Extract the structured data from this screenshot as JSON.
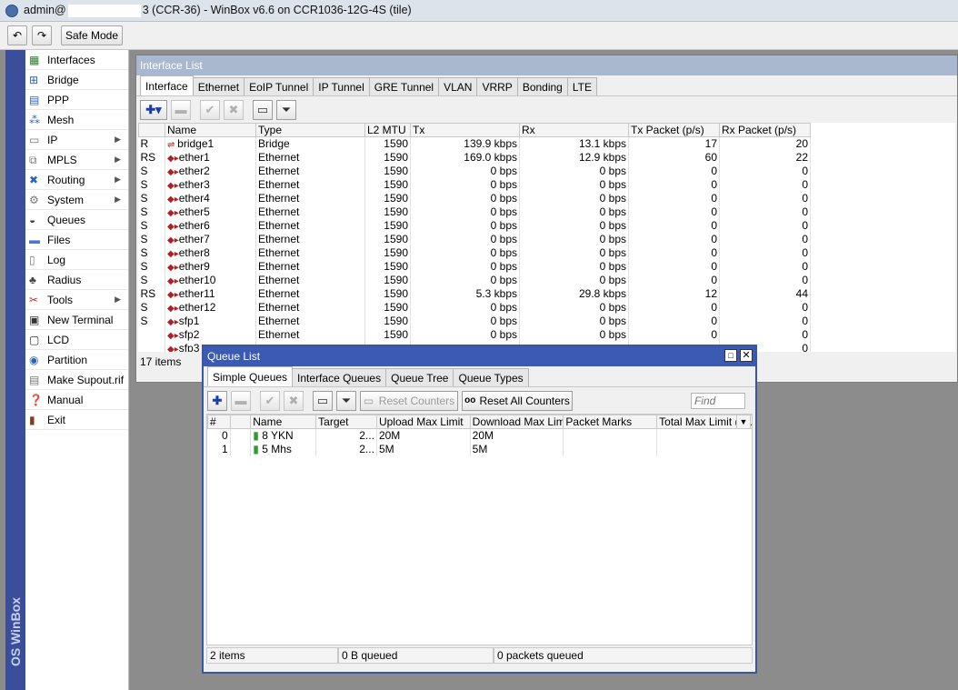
{
  "window": {
    "title_prefix": "admin@",
    "title_suffix": "3 (CCR-36) - WinBox v6.6 on CCR1036-12G-4S (tile)"
  },
  "toolbar": {
    "undo_icon": "undo-icon",
    "redo_icon": "redo-icon",
    "safe_mode": "Safe Mode"
  },
  "sidebar": {
    "brand": "OS WinBox",
    "items": [
      {
        "label": "Interfaces",
        "icon": "interfaces-icon",
        "sub": false
      },
      {
        "label": "Bridge",
        "icon": "bridge-icon",
        "sub": false
      },
      {
        "label": "PPP",
        "icon": "ppp-icon",
        "sub": false
      },
      {
        "label": "Mesh",
        "icon": "mesh-icon",
        "sub": false
      },
      {
        "label": "IP",
        "icon": "ip-icon",
        "sub": true
      },
      {
        "label": "MPLS",
        "icon": "mpls-icon",
        "sub": true
      },
      {
        "label": "Routing",
        "icon": "routing-icon",
        "sub": true
      },
      {
        "label": "System",
        "icon": "system-icon",
        "sub": true
      },
      {
        "label": "Queues",
        "icon": "queues-icon",
        "sub": false
      },
      {
        "label": "Files",
        "icon": "files-icon",
        "sub": false
      },
      {
        "label": "Log",
        "icon": "log-icon",
        "sub": false
      },
      {
        "label": "Radius",
        "icon": "radius-icon",
        "sub": false
      },
      {
        "label": "Tools",
        "icon": "tools-icon",
        "sub": true
      },
      {
        "label": "New Terminal",
        "icon": "terminal-icon",
        "sub": false
      },
      {
        "label": "LCD",
        "icon": "lcd-icon",
        "sub": false
      },
      {
        "label": "Partition",
        "icon": "partition-icon",
        "sub": false
      },
      {
        "label": "Make Supout.rif",
        "icon": "supout-icon",
        "sub": false
      },
      {
        "label": "Manual",
        "icon": "manual-icon",
        "sub": false
      },
      {
        "label": "Exit",
        "icon": "exit-icon",
        "sub": false
      }
    ]
  },
  "interface_list": {
    "title": "Interface List",
    "tabs": [
      "Interface",
      "Ethernet",
      "EoIP Tunnel",
      "IP Tunnel",
      "GRE Tunnel",
      "VLAN",
      "VRRP",
      "Bonding",
      "LTE"
    ],
    "columns": [
      "",
      "Name",
      "Type",
      "L2 MTU",
      "Tx",
      "Rx",
      "Tx Packet (p/s)",
      "Rx Packet (p/s)"
    ],
    "rows": [
      [
        "R",
        "bridge1",
        "Bridge",
        "1590",
        "139.9 kbps",
        "13.1 kbps",
        "17",
        "20"
      ],
      [
        "RS",
        "ether1",
        "Ethernet",
        "1590",
        "169.0 kbps",
        "12.9 kbps",
        "60",
        "22"
      ],
      [
        "S",
        "ether2",
        "Ethernet",
        "1590",
        "0 bps",
        "0 bps",
        "0",
        "0"
      ],
      [
        "S",
        "ether3",
        "Ethernet",
        "1590",
        "0 bps",
        "0 bps",
        "0",
        "0"
      ],
      [
        "S",
        "ether4",
        "Ethernet",
        "1590",
        "0 bps",
        "0 bps",
        "0",
        "0"
      ],
      [
        "S",
        "ether5",
        "Ethernet",
        "1590",
        "0 bps",
        "0 bps",
        "0",
        "0"
      ],
      [
        "S",
        "ether6",
        "Ethernet",
        "1590",
        "0 bps",
        "0 bps",
        "0",
        "0"
      ],
      [
        "S",
        "ether7",
        "Ethernet",
        "1590",
        "0 bps",
        "0 bps",
        "0",
        "0"
      ],
      [
        "S",
        "ether8",
        "Ethernet",
        "1590",
        "0 bps",
        "0 bps",
        "0",
        "0"
      ],
      [
        "S",
        "ether9",
        "Ethernet",
        "1590",
        "0 bps",
        "0 bps",
        "0",
        "0"
      ],
      [
        "S",
        "ether10",
        "Ethernet",
        "1590",
        "0 bps",
        "0 bps",
        "0",
        "0"
      ],
      [
        "RS",
        "ether11",
        "Ethernet",
        "1590",
        "5.3 kbps",
        "29.8 kbps",
        "12",
        "44"
      ],
      [
        "S",
        "ether12",
        "Ethernet",
        "1590",
        "0 bps",
        "0 bps",
        "0",
        "0"
      ],
      [
        "S",
        "sfp1",
        "Ethernet",
        "1590",
        "0 bps",
        "0 bps",
        "0",
        "0"
      ],
      [
        "",
        "sfp2",
        "Ethernet",
        "1590",
        "0 bps",
        "0 bps",
        "0",
        "0"
      ],
      [
        "",
        "sfp3",
        "",
        "",
        "",
        "",
        "",
        "0"
      ]
    ],
    "status": "17 items"
  },
  "queue_list": {
    "title": "Queue List",
    "tabs": [
      "Simple Queues",
      "Interface Queues",
      "Queue Tree",
      "Queue Types"
    ],
    "reset_counters": "Reset Counters",
    "reset_all_counters": "Reset All Counters",
    "find_placeholder": "Find",
    "columns": [
      "#",
      "",
      "Name",
      "Target",
      "Upload Max Limit",
      "Download Max Limit",
      "Packet Marks",
      "Total Max Limit (bi..."
    ],
    "rows": [
      [
        "0",
        "",
        "8 YKN",
        "2...",
        "20M",
        "20M",
        "",
        ""
      ],
      [
        "1",
        "",
        "5 Mhs",
        "2...",
        "5M",
        "5M",
        "",
        ""
      ]
    ],
    "status": [
      "2 items",
      "0 B queued",
      "0 packets queued"
    ]
  }
}
